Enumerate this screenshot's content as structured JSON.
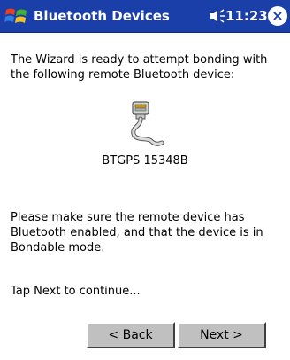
{
  "window": {
    "title": "Bluetooth Devices",
    "time": "11:23",
    "accent_color": "#1a3fa8",
    "icons": {
      "start": "windows-flag-icon",
      "volume": "speaker-icon",
      "close": "close-icon"
    },
    "close_glyph": "×"
  },
  "wizard": {
    "intro": "The Wizard is ready to attempt bonding with the following remote Bluetooth device:",
    "device_icon": "serial-cable-icon",
    "device_name": "BTGPS 15348B",
    "instructions": "Please make sure the remote device has Bluetooth enabled, and that the device is in Bondable mode.",
    "hint": "Tap Next to continue..."
  },
  "buttons": {
    "back_label": "< Back",
    "next_label": "Next >"
  }
}
